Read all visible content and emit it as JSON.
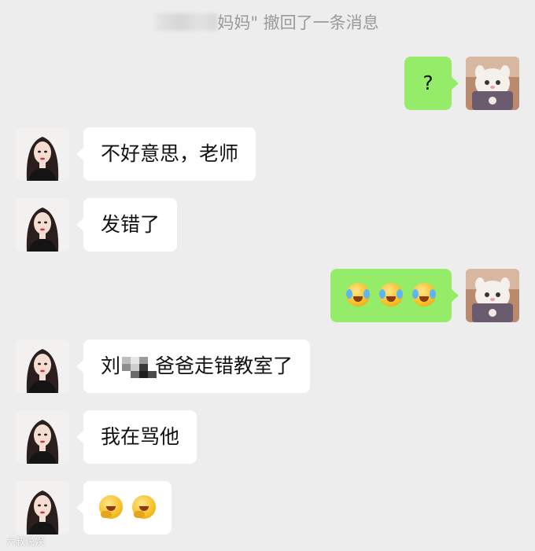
{
  "system_notice": {
    "text": "妈妈\" 撤回了一条消息"
  },
  "messages": [
    {
      "side": "right",
      "text": "?"
    },
    {
      "side": "left",
      "text": "不好意思，老师"
    },
    {
      "side": "left",
      "text": "发错了"
    },
    {
      "side": "right",
      "emoji": "face-with-tears-of-joy",
      "count": 3
    },
    {
      "side": "left",
      "prefix": "刘",
      "suffix": "爸爸走错教室了"
    },
    {
      "side": "left",
      "text": "我在骂他"
    },
    {
      "side": "left",
      "emoji": "hand-over-mouth-smile",
      "count": 2
    }
  ],
  "colors": {
    "background": "#ededed",
    "self_bubble": "#95ec69",
    "other_bubble": "#ffffff",
    "notice_text": "#9a9a9a"
  },
  "avatars": {
    "self": "cat-avatar",
    "other": "woman-avatar"
  },
  "watermark": "六叔说娱"
}
